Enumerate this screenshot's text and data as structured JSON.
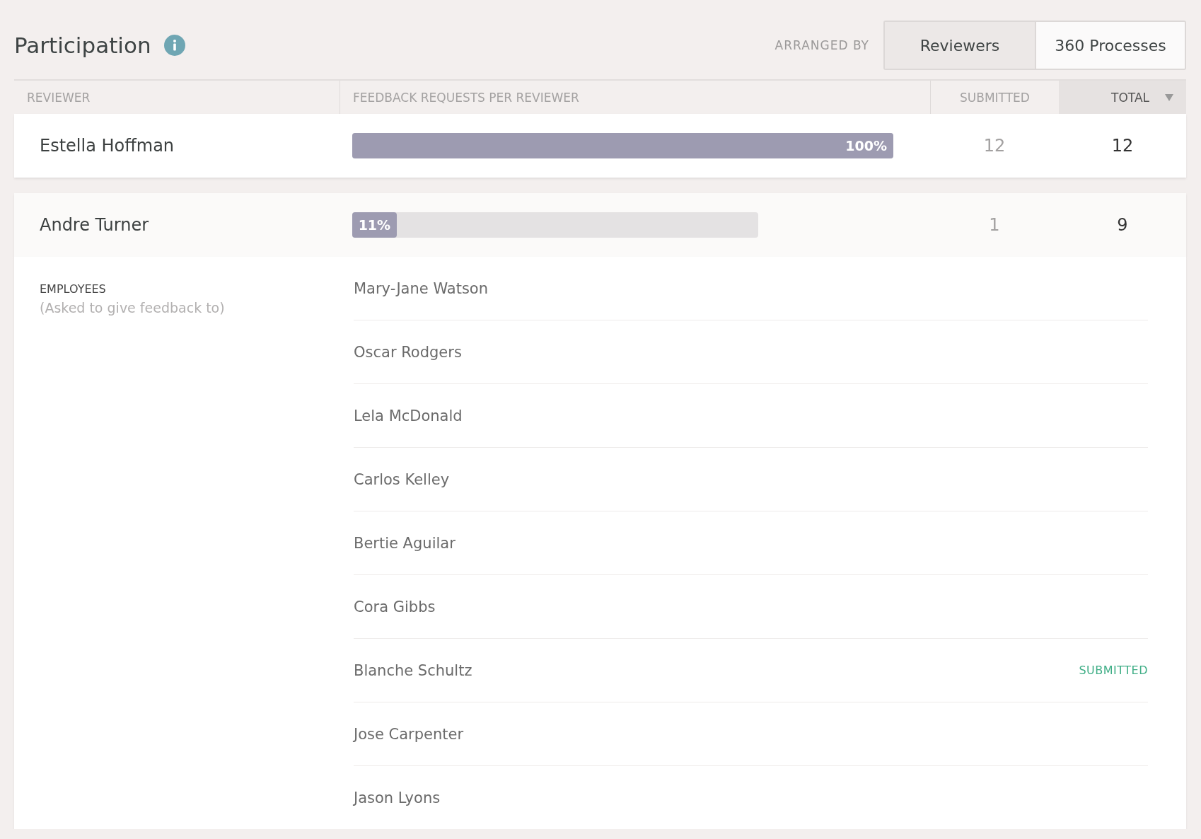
{
  "title": "Participation",
  "arranged_by": {
    "label": "ARRANGED BY",
    "options": [
      {
        "label": "Reviewers",
        "selected": true
      },
      {
        "label": "360 Processes",
        "selected": false
      }
    ]
  },
  "table": {
    "columns": [
      {
        "label": "REVIEWER",
        "sorted": false
      },
      {
        "label": "FEEDBACK REQUESTS PER REVIEWER",
        "sorted": false
      },
      {
        "label": "SUBMITTED",
        "sorted": false
      },
      {
        "label": "TOTAL",
        "sorted": true
      }
    ],
    "rows": [
      {
        "name": "Estella Hoffman",
        "percent": "100%",
        "level": 1,
        "submitted": "12",
        "total": "12",
        "expanded": false
      },
      {
        "name": "Andre Turner",
        "percent": "11%",
        "level": 0.11,
        "submitted": "1",
        "total": "9",
        "expanded": true,
        "details": {
          "heading": "EMPLOYEES",
          "subheading": "(Asked to give feedback to)",
          "employees": [
            {
              "name": "Mary-Jane Watson"
            },
            {
              "name": "Oscar Rodgers"
            },
            {
              "name": "Lela McDonald"
            },
            {
              "name": "Carlos Kelley"
            },
            {
              "name": "Bertie Aguilar"
            },
            {
              "name": "Cora Gibbs"
            },
            {
              "name": "Blanche Schultz",
              "status": "SUBMITTED"
            },
            {
              "name": "Jose Carpenter"
            },
            {
              "name": "Jason Lyons"
            }
          ]
        }
      }
    ]
  }
}
